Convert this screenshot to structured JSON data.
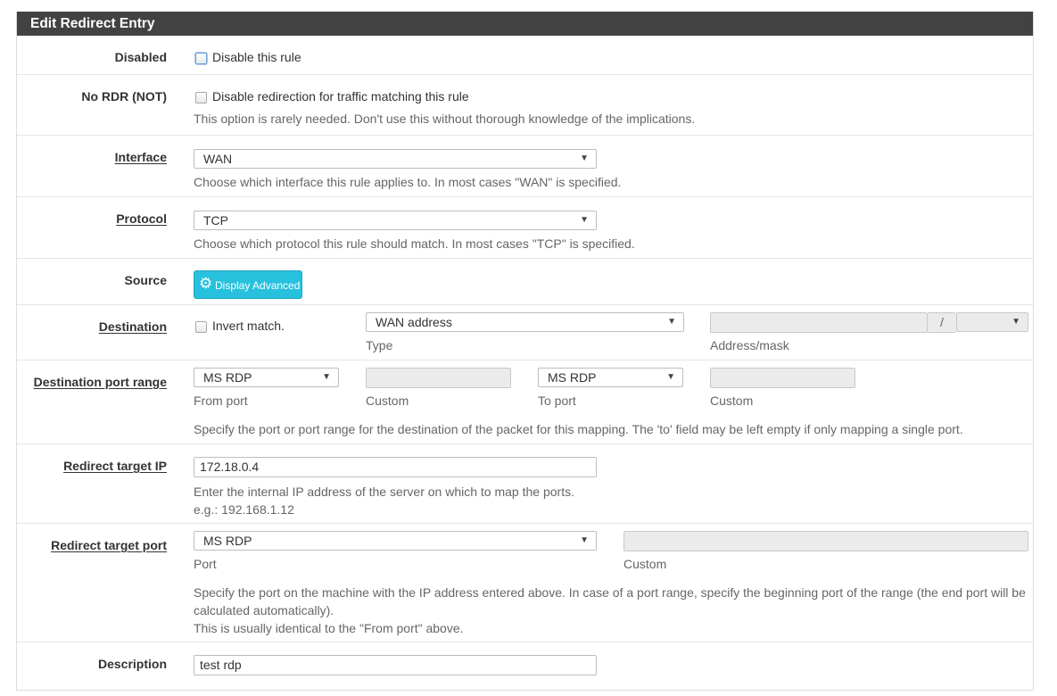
{
  "panel": {
    "title": "Edit Redirect Entry"
  },
  "disabled": {
    "label": "Disabled",
    "checkbox_label": "Disable this rule"
  },
  "nordr": {
    "label": "No RDR (NOT)",
    "checkbox_label": "Disable redirection for traffic matching this rule",
    "help": "This option is rarely needed. Don't use this without thorough knowledge of the implications."
  },
  "interface": {
    "label": "Interface",
    "value": "WAN",
    "help": "Choose which interface this rule applies to. In most cases \"WAN\" is specified."
  },
  "protocol": {
    "label": "Protocol",
    "value": "TCP",
    "help": "Choose which protocol this rule should match. In most cases \"TCP\" is specified."
  },
  "source": {
    "label": "Source",
    "button_label": "Display Advanced"
  },
  "destination": {
    "label": "Destination",
    "invert_label": "Invert match.",
    "type_value": "WAN address",
    "type_caption": "Type",
    "address_caption": "Address/mask",
    "mask_separator": "/"
  },
  "dest_port": {
    "label": "Destination port range",
    "from_value": "MS RDP",
    "from_caption": "From port",
    "custom_caption_1": "Custom",
    "to_value": "MS RDP",
    "to_caption": "To port",
    "custom_caption_2": "Custom",
    "help": "Specify the port or port range for the destination of the packet for this mapping. The 'to' field may be left empty if only mapping a single port."
  },
  "target_ip": {
    "label": "Redirect target IP",
    "value": "172.18.0.4",
    "help": "Enter the internal IP address of the server on which to map the ports.",
    "example": "e.g.: 192.168.1.12"
  },
  "target_port": {
    "label": "Redirect target port",
    "value": "MS RDP",
    "port_caption": "Port",
    "custom_caption": "Custom",
    "help_line1": "Specify the port on the machine with the IP address entered above. In case of a port range, specify the beginning port of the range (the end port will be",
    "help_line2": "calculated automatically).",
    "help_line3": "This is usually identical to the \"From port\" above."
  },
  "description": {
    "label": "Description",
    "value": "test rdp"
  },
  "icons": {
    "caret": "caret-down-icon",
    "gear": "gear-icon"
  },
  "colors": {
    "header_bg": "#424242",
    "button_bg": "#27c1de"
  }
}
